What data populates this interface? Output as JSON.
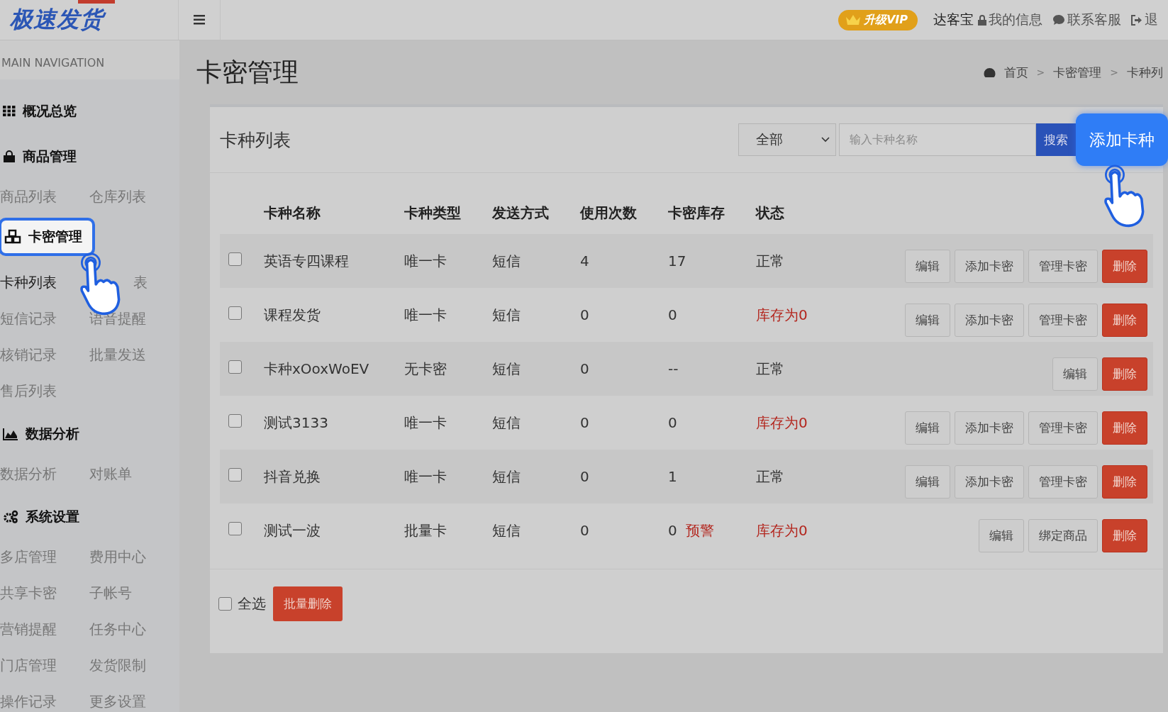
{
  "header": {
    "logo": "极速发货",
    "vip_badge": "升级VIP",
    "user": "达客宝",
    "links": [
      {
        "kind": "lock",
        "label": "我的信息"
      },
      {
        "kind": "chat",
        "label": "联系客服"
      },
      {
        "kind": "exit",
        "label": "退"
      }
    ]
  },
  "sidebar": {
    "heading": "MAIN NAVIGATION",
    "sections": [
      {
        "kind": "grid",
        "title": "概况总览",
        "highlighted": false
      },
      {
        "kind": "bag",
        "title": "商品管理",
        "highlighted": false,
        "items": [
          {
            "label": "商品列表",
            "selected": false
          },
          {
            "label": "仓库列表",
            "selected": false
          }
        ]
      },
      {
        "kind": "cubes",
        "title": "卡密管理",
        "highlighted": true,
        "items": [
          {
            "label": "卡种列表",
            "selected": true
          },
          {
            "label": "表",
            "selected": false,
            "kind": "covered"
          },
          {
            "label": "短信记录",
            "selected": false
          },
          {
            "label": "语音提醒",
            "selected": false
          },
          {
            "label": "核销记录",
            "selected": false
          },
          {
            "label": "批量发送",
            "selected": false
          },
          {
            "label": "售后列表",
            "selected": false
          }
        ]
      },
      {
        "kind": "chart",
        "title": "数据分析",
        "highlighted": false,
        "items": [
          {
            "label": "数据分析",
            "selected": false
          },
          {
            "label": "对账单",
            "selected": false
          }
        ]
      },
      {
        "kind": "gears",
        "title": "系统设置",
        "highlighted": false,
        "items": [
          {
            "label": "多店管理",
            "selected": false
          },
          {
            "label": "费用中心",
            "selected": false
          },
          {
            "label": "共享卡密",
            "selected": false
          },
          {
            "label": "子帐号",
            "selected": false
          },
          {
            "label": "营销提醒",
            "selected": false
          },
          {
            "label": "任务中心",
            "selected": false
          },
          {
            "label": "门店管理",
            "selected": false
          },
          {
            "label": "发货限制",
            "selected": false
          },
          {
            "label": "操作记录",
            "selected": false
          },
          {
            "label": "更多设置",
            "selected": false
          }
        ]
      }
    ]
  },
  "page_title": "卡密管理",
  "breadcrumb": [
    {
      "label": "首页"
    },
    {
      "separator": ">",
      "label": "卡密管理"
    },
    {
      "separator": ">",
      "label": "卡种列"
    }
  ],
  "card": {
    "title": "卡种列表",
    "filter": "全部",
    "search": {
      "placeholder": "输入卡种名称",
      "button": "搜索"
    },
    "add_button": {
      "label": "添加卡种",
      "highlighted": true
    },
    "columns": [
      "卡种名称",
      "卡种类型",
      "发送方式",
      "使用次数",
      "卡密库存",
      "状态"
    ],
    "rows": [
      {
        "checked": false,
        "name": "英语专四课程",
        "type": "唯一卡",
        "send": "短信",
        "uses": "4",
        "stock": "17",
        "status": {
          "kind": "ok",
          "text": "正常"
        },
        "actions": [
          {
            "kind": "default",
            "label": "编辑"
          },
          {
            "kind": "default",
            "label": "添加卡密"
          },
          {
            "kind": "default",
            "label": "管理卡密"
          },
          {
            "kind": "danger",
            "label": "删除"
          }
        ]
      },
      {
        "checked": false,
        "name": "课程发货",
        "type": "唯一卡",
        "send": "短信",
        "uses": "0",
        "stock": "0",
        "status": {
          "kind": "alert",
          "text": "库存为0"
        },
        "actions": [
          {
            "kind": "default",
            "label": "编辑"
          },
          {
            "kind": "default",
            "label": "添加卡密"
          },
          {
            "kind": "default",
            "label": "管理卡密"
          },
          {
            "kind": "danger",
            "label": "删除"
          }
        ]
      },
      {
        "checked": false,
        "name": "卡种xOoxWoEV",
        "type": "无卡密",
        "send": "短信",
        "uses": "0",
        "stock": "--",
        "status": {
          "kind": "ok",
          "text": "正常"
        },
        "actions": [
          {
            "kind": "default",
            "label": "编辑"
          },
          {
            "kind": "danger",
            "label": "删除"
          }
        ]
      },
      {
        "checked": false,
        "name": "测试3133",
        "type": "唯一卡",
        "send": "短信",
        "uses": "0",
        "stock": "0",
        "status": {
          "kind": "alert",
          "text": "库存为0"
        },
        "actions": [
          {
            "kind": "default",
            "label": "编辑"
          },
          {
            "kind": "default",
            "label": "添加卡密"
          },
          {
            "kind": "default",
            "label": "管理卡密"
          },
          {
            "kind": "danger",
            "label": "删除"
          }
        ]
      },
      {
        "checked": false,
        "name": "抖音兑换",
        "type": "唯一卡",
        "send": "短信",
        "uses": "0",
        "stock": "1",
        "status": {
          "kind": "ok",
          "text": "正常"
        },
        "actions": [
          {
            "kind": "default",
            "label": "编辑"
          },
          {
            "kind": "default",
            "label": "添加卡密"
          },
          {
            "kind": "default",
            "label": "管理卡密"
          },
          {
            "kind": "danger",
            "label": "删除"
          }
        ]
      },
      {
        "checked": false,
        "name": "测试一波",
        "type": "批量卡",
        "send": "短信",
        "uses": "0",
        "stock": "0",
        "stock_warning": "预警",
        "status": {
          "kind": "alert",
          "text": "库存为0"
        },
        "actions": [
          {
            "kind": "default",
            "label": "编辑"
          },
          {
            "kind": "default",
            "label": "绑定商品"
          },
          {
            "kind": "danger",
            "label": "删除"
          }
        ]
      }
    ],
    "footer": {
      "select_all": {
        "label": "全选",
        "checked": false
      },
      "batch_delete": "批量删除"
    }
  }
}
